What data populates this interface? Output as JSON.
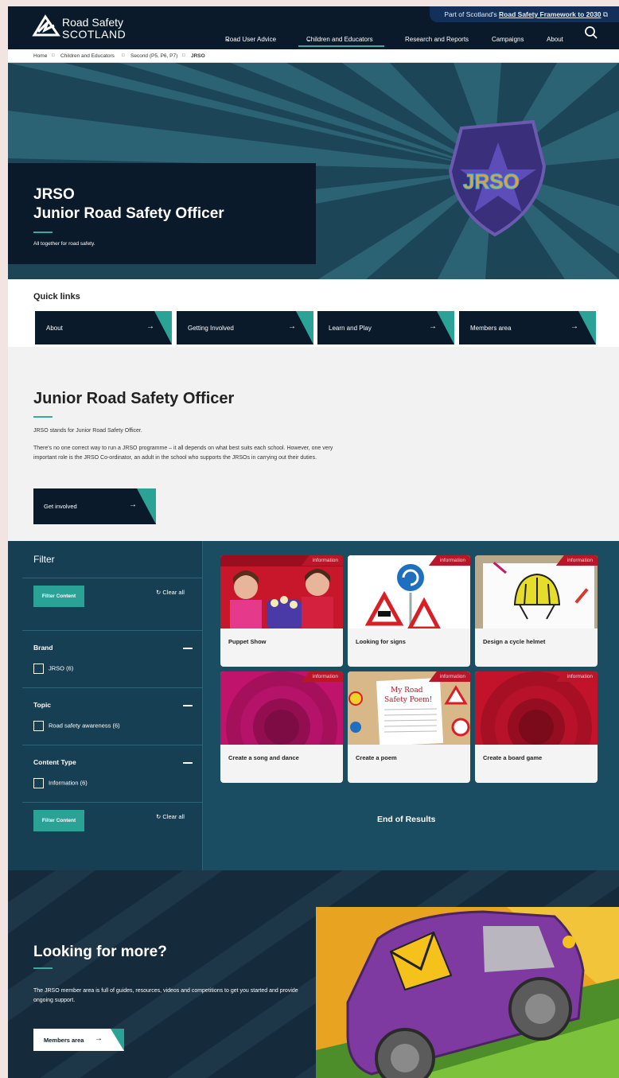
{
  "header": {
    "framework_prefix": "Part of Scotland's",
    "framework_link": "Road Safety Framework to 2030",
    "logo_line1": "Road Safety",
    "logo_line2": "SCOTLAND",
    "nav": [
      "Road User Advice",
      "Children and Educators",
      "Research and Reports",
      "Campaigns",
      "About"
    ],
    "active_nav": "Children and Educators"
  },
  "breadcrumb": [
    "Home",
    "Children and Educators",
    "Second (P5, P6, P7)",
    "JRSO"
  ],
  "hero": {
    "title_line1": "JRSO",
    "title_line2": "Junior Road Safety Officer",
    "subtitle": "All together for road safety.",
    "badge_text": "JRSO"
  },
  "quick_links": {
    "title": "Quick links",
    "items": [
      "About",
      "Getting Involved",
      "Learn and Play",
      "Members area"
    ]
  },
  "intro": {
    "title": "Junior Road Safety Officer",
    "p1": "JRSO stands for Junior Road Safety Officer.",
    "p2": "There's no one correct way to run a JRSO programme – it all depends on what best suits each school. However, one very important role is the JRSO Co-ordinator, an adult in the school who supports the JRSOs in carrying out their duties.",
    "button": "Get involved"
  },
  "filter": {
    "title": "Filter",
    "button": "Filter Content",
    "clear": "Clear all",
    "groups": [
      {
        "name": "Brand",
        "option": "JRSO (6)"
      },
      {
        "name": "Topic",
        "option": "Road safety awareness (6)"
      },
      {
        "name": "Content Type",
        "option": "Information (6)"
      }
    ]
  },
  "cards": [
    {
      "title": "Puppet Show",
      "tag": "information"
    },
    {
      "title": "Looking for signs",
      "tag": "information"
    },
    {
      "title": "Design a cycle helmet",
      "tag": "information"
    },
    {
      "title": "Create a song and dance",
      "tag": "information"
    },
    {
      "title": "Create a poem",
      "tag": "information",
      "image_text": "My Road Safety Poem!"
    },
    {
      "title": "Create a board game",
      "tag": "information"
    }
  ],
  "end_of_results": "End of Results",
  "more": {
    "title": "Looking for more?",
    "text": "The JRSO member area is full of guides, resources, videos and competitions to get you started and provide ongoing support.",
    "button": "Members area"
  },
  "colors": {
    "navy": "#0b1a2a",
    "teal": "#2aa296",
    "filter_bg": "#163f53",
    "results_bg": "#1a4d62",
    "tag_red": "#b9162a"
  }
}
